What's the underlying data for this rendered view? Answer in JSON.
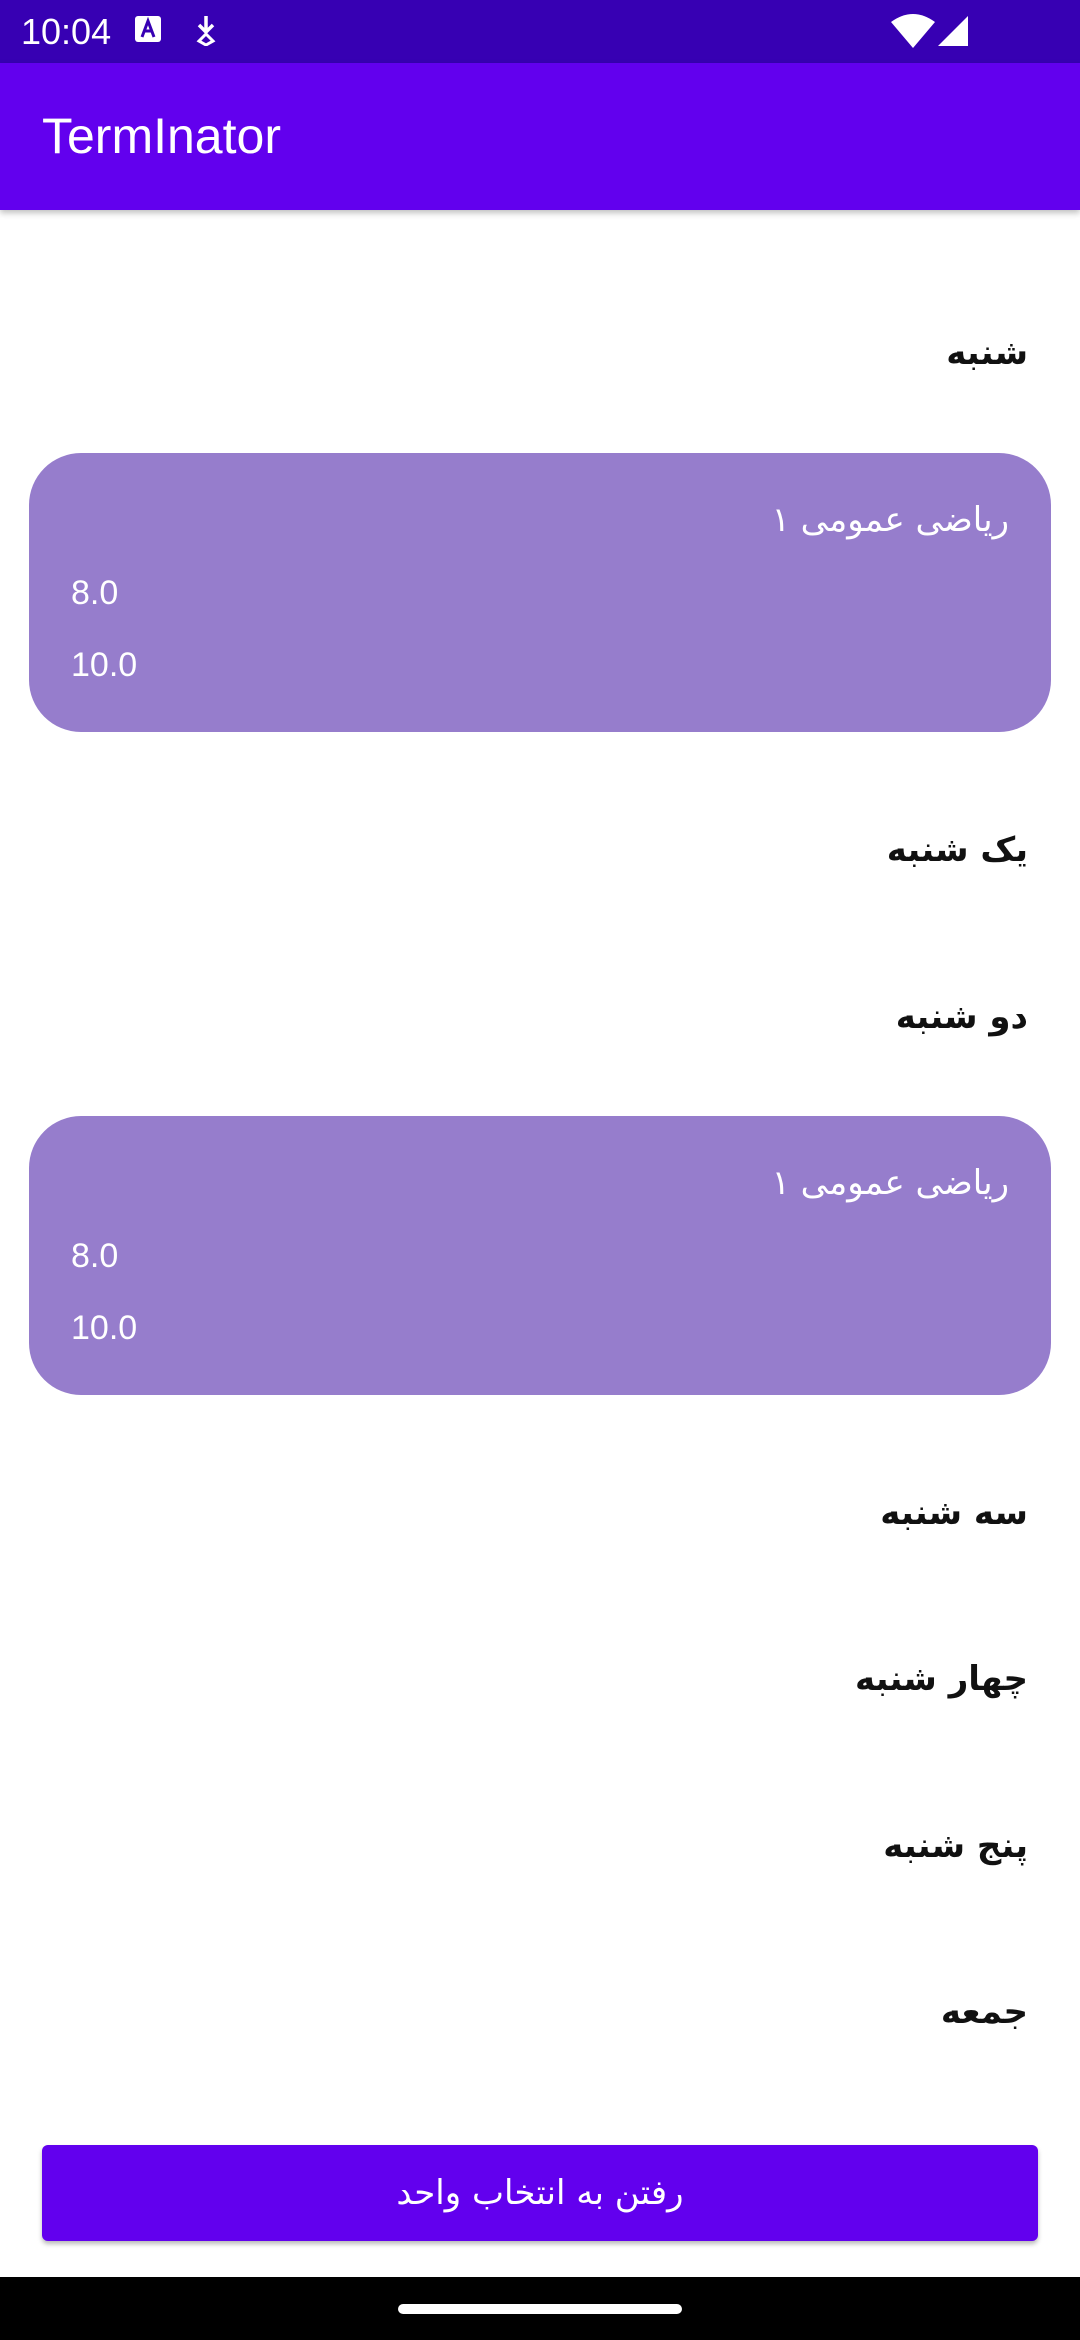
{
  "status_bar": {
    "time": "10:04",
    "icons": [
      "text-a-icon",
      "download-icon",
      "wifi-icon",
      "signal-icon"
    ]
  },
  "app_bar": {
    "title": "TermInator"
  },
  "schedule": {
    "days": [
      {
        "name": "شنبه"
      },
      {
        "name": "یک شنبه"
      },
      {
        "name": "دو شنبه"
      },
      {
        "name": "سه شنبه"
      },
      {
        "name": "چهار شنبه"
      },
      {
        "name": "پنج شنبه"
      },
      {
        "name": "جمعه"
      }
    ],
    "classes": [
      {
        "course": "ریاضی عمومی ۱",
        "start": "8.0",
        "end": "10.0"
      },
      {
        "course": "ریاضی عمومی ۱",
        "start": "8.0",
        "end": "10.0"
      }
    ]
  },
  "footer": {
    "button_label": "رفتن به انتخاب واحد"
  },
  "colors": {
    "status_bar": "#3700b3",
    "app_bar": "#6200ee",
    "card": "#967dcc",
    "button": "#6200ee"
  }
}
